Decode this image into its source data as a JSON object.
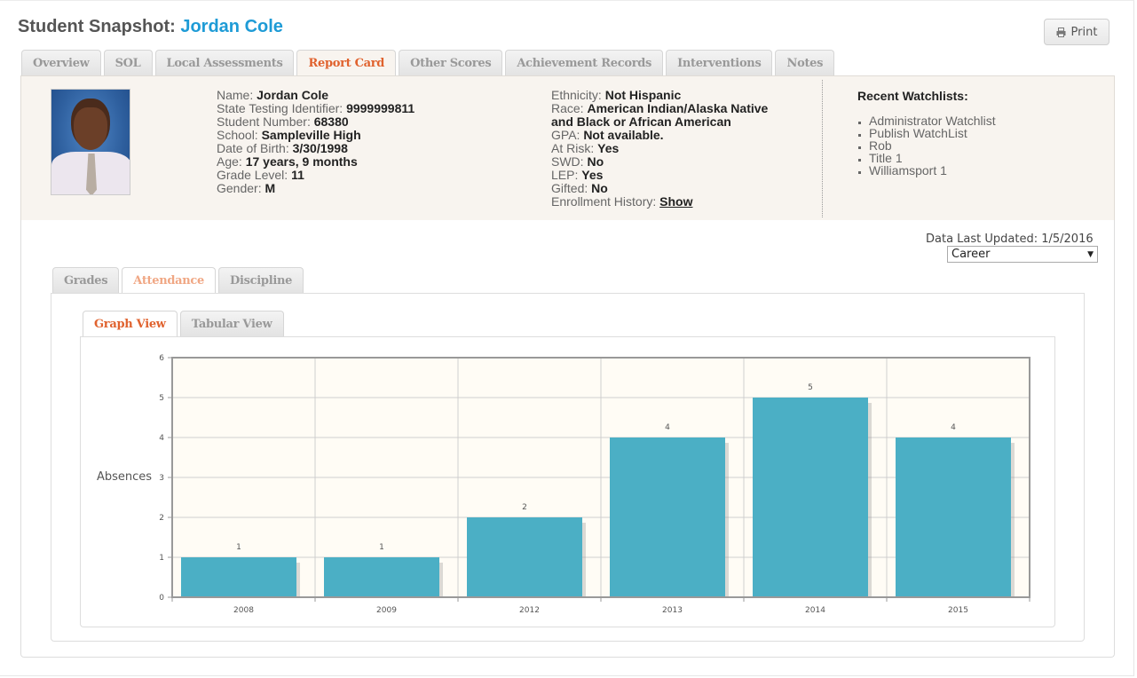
{
  "header": {
    "title_prefix": "Student Snapshot:",
    "student_name": "Jordan Cole",
    "print_label": "Print"
  },
  "main_tabs": [
    {
      "label": "Overview",
      "active": false
    },
    {
      "label": "SOL",
      "active": false
    },
    {
      "label": "Local Assessments",
      "active": false
    },
    {
      "label": "Report Card",
      "active": true
    },
    {
      "label": "Other Scores",
      "active": false
    },
    {
      "label": "Achievement Records",
      "active": false
    },
    {
      "label": "Interventions",
      "active": false
    },
    {
      "label": "Notes",
      "active": false
    }
  ],
  "student": {
    "col1": [
      {
        "label": "Name:",
        "value": "Jordan Cole"
      },
      {
        "label": "State Testing Identifier:",
        "value": "9999999811"
      },
      {
        "label": "Student Number:",
        "value": "68380"
      },
      {
        "label": "School:",
        "value": "Sampleville High"
      },
      {
        "label": "Date of Birth:",
        "value": "3/30/1998"
      },
      {
        "label": "Age:",
        "value": "17 years, 9 months"
      },
      {
        "label": "Grade Level:",
        "value": "11"
      },
      {
        "label": "Gender:",
        "value": "M"
      }
    ],
    "col2": [
      {
        "label": "Ethnicity:",
        "value": "Not Hispanic"
      },
      {
        "label": "Race:",
        "value": "American Indian/Alaska Native"
      },
      {
        "label": "",
        "value": "and Black or African American"
      },
      {
        "label": "GPA:",
        "value": "Not available."
      },
      {
        "label": "At Risk:",
        "value": "Yes"
      },
      {
        "label": "SWD:",
        "value": "No"
      },
      {
        "label": "LEP:",
        "value": "Yes"
      },
      {
        "label": "Gifted:",
        "value": "No"
      }
    ],
    "enrollment_label": "Enrollment History:",
    "enrollment_link": "Show"
  },
  "watchlists": {
    "heading": "Recent Watchlists:",
    "items": [
      "Administrator Watchlist",
      "Publish WatchList",
      "Rob",
      "Title 1",
      "Williamsport 1"
    ]
  },
  "data_updated": "Data Last Updated: 1/5/2016",
  "period_select": {
    "selected": "Career"
  },
  "section_tabs": [
    {
      "label": "Grades",
      "active": false
    },
    {
      "label": "Attendance",
      "active": true
    },
    {
      "label": "Discipline",
      "active": false
    }
  ],
  "view_tabs": [
    {
      "label": "Graph View",
      "active": true
    },
    {
      "label": "Tabular View",
      "active": false
    }
  ],
  "colors": {
    "accent_name": "#1e9bd6",
    "active_tab": "#e0622e",
    "bar": "#4bafc5",
    "plot_bg": "#fffcf5"
  },
  "chart_data": {
    "type": "bar",
    "title": "",
    "xlabel": "",
    "ylabel": "Absences",
    "categories": [
      "2008",
      "2009",
      "2012",
      "2013",
      "2014",
      "2015"
    ],
    "values": [
      1,
      1,
      2,
      4,
      5,
      4
    ],
    "ylim": [
      0,
      6
    ],
    "yticks": [
      0,
      1,
      2,
      3,
      4,
      5,
      6
    ],
    "grid": true,
    "data_labels": true,
    "legend": "none"
  }
}
